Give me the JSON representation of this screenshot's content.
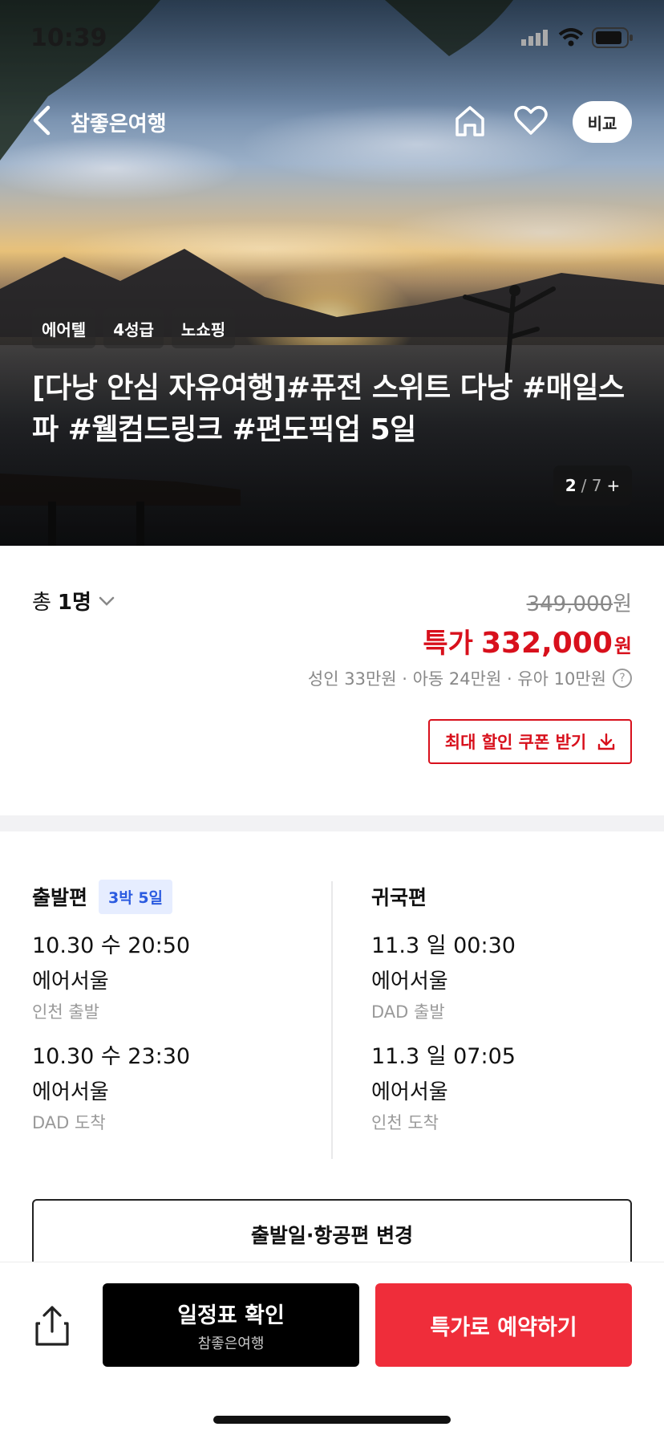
{
  "status": {
    "time": "10:39"
  },
  "header": {
    "brand": "참좋은여행",
    "compare_label": "비교"
  },
  "hero": {
    "tags": [
      "에어텔",
      "4성급",
      "노쇼핑"
    ],
    "title": "[다낭 안심 자유여행]#퓨전 스위트 다낭 #매일스파 #웰컴드링크 #편도픽업 5일",
    "image_index": "2",
    "image_total": "/ 7",
    "image_more": "+"
  },
  "price": {
    "pax_label": "총",
    "pax_count": "1명",
    "original": "349,000",
    "original_unit": "원",
    "sale_label": "특가",
    "sale_amount": "332,000",
    "sale_unit": "원",
    "breakdown": "성인 33만원 · 아동 24만원 · 유아 10만원",
    "help_glyph": "?",
    "coupon_label": "최대 할인 쿠폰 받기"
  },
  "flight": {
    "departure": {
      "title": "출발편",
      "badge": "3박 5일",
      "legs": [
        {
          "datetime": "10.30 수 20:50",
          "airline": "에어서울",
          "place": "인천 출발"
        },
        {
          "datetime": "10.30 수 23:30",
          "airline": "에어서울",
          "place": "DAD 도착"
        }
      ]
    },
    "return": {
      "title": "귀국편",
      "legs": [
        {
          "datetime": "11.3 일 00:30",
          "airline": "에어서울",
          "place": "DAD 출발"
        },
        {
          "datetime": "11.3 일 07:05",
          "airline": "에어서울",
          "place": "인천 도착"
        }
      ]
    },
    "change_label": "출발일·항공편 변경"
  },
  "bottom": {
    "schedule_label": "일정표 확인",
    "schedule_sub": "참좋은여행",
    "book_label": "특가로 예약하기"
  },
  "colors": {
    "accent_red": "#d8101c",
    "book_button": "#ef2d3a",
    "badge_blue": "#2b5be0"
  }
}
